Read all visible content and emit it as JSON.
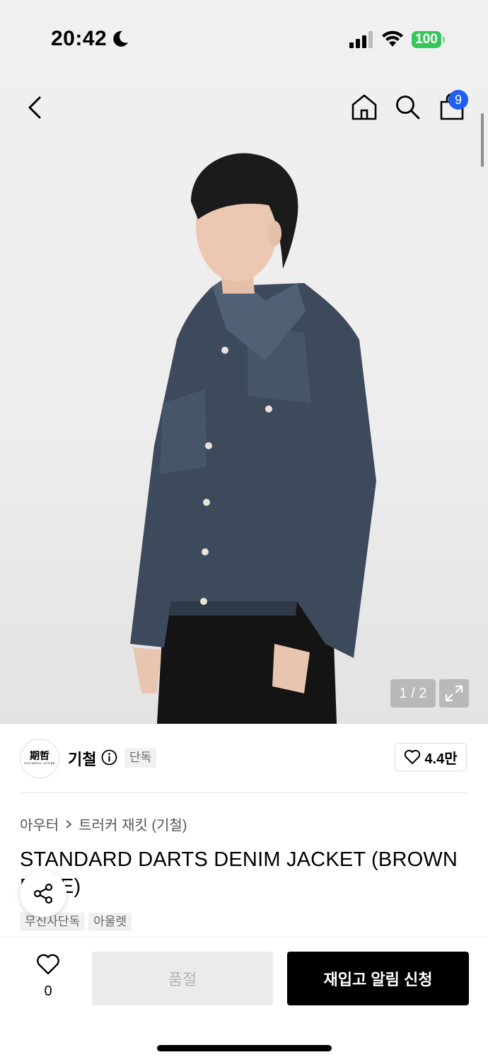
{
  "status_bar": {
    "time": "20:42",
    "battery": "100",
    "icons": [
      "moon-icon",
      "signal-icon",
      "wifi-icon",
      "battery-icon"
    ],
    "battery_color": "#34c759"
  },
  "nav": {
    "icons": [
      "back-icon",
      "home-icon",
      "search-icon",
      "cart-icon"
    ],
    "cart_count": "9",
    "badge_color": "#1e5ff0"
  },
  "gallery": {
    "counter": "1 / 2",
    "expand_icon": "expand-icon"
  },
  "brand": {
    "logo_text": "期哲",
    "logo_subtext": "GIICHEOL STORE",
    "name": "기철",
    "badge": "단독",
    "like_count": "4.4만"
  },
  "product": {
    "breadcrumb": [
      "아우터",
      "트러커 재킷 (기철)"
    ],
    "title": "STANDARD DARTS DENIM JACKET (BROWN BLUE)",
    "tags": [
      "무신사단독",
      "아울렛"
    ]
  },
  "actions": {
    "wish_count": "0",
    "soldout_label": "품절",
    "restock_label": "재입고 알림 신청"
  }
}
